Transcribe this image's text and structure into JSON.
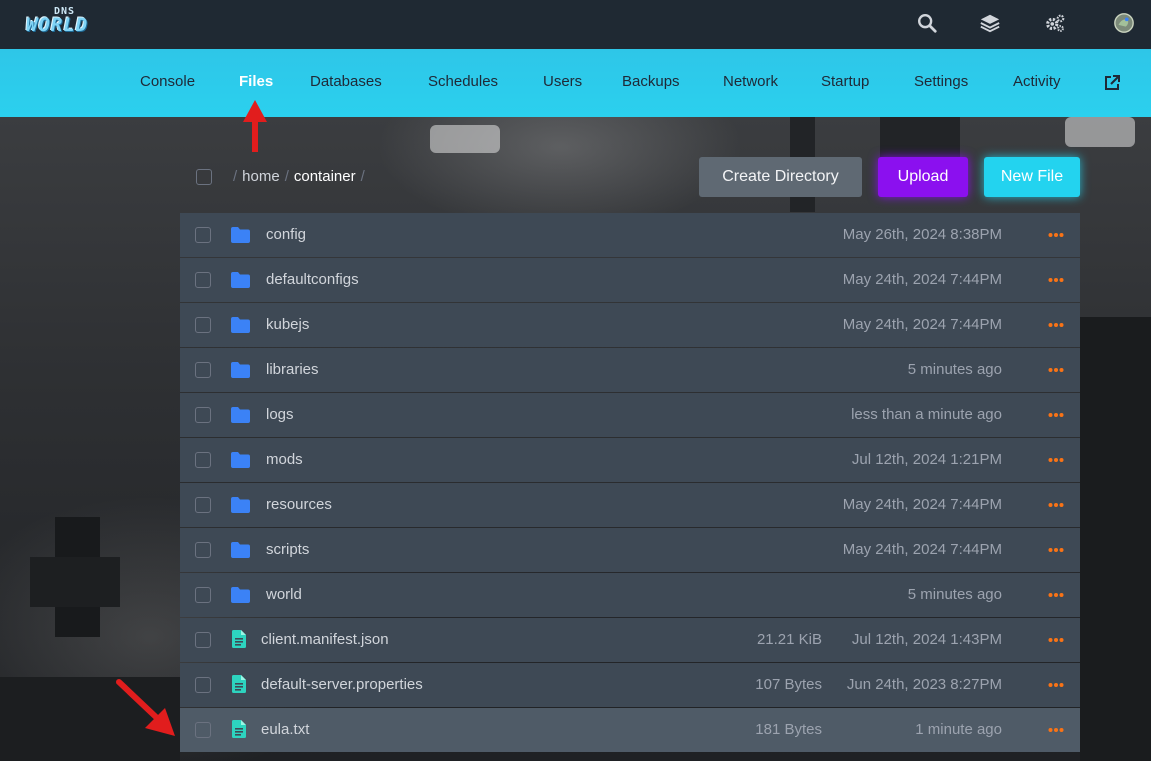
{
  "app": {
    "logo_top": "DNS",
    "logo_main": "WORLD"
  },
  "header": {
    "icons": [
      "search-icon",
      "layers-icon",
      "cogs-icon",
      "avatar-icon"
    ]
  },
  "nav": {
    "items": [
      {
        "label": "Console",
        "active": false
      },
      {
        "label": "Files",
        "active": true
      },
      {
        "label": "Databases",
        "active": false
      },
      {
        "label": "Schedules",
        "active": false
      },
      {
        "label": "Users",
        "active": false
      },
      {
        "label": "Backups",
        "active": false
      },
      {
        "label": "Network",
        "active": false
      },
      {
        "label": "Startup",
        "active": false
      },
      {
        "label": "Settings",
        "active": false
      },
      {
        "label": "Activity",
        "active": false
      }
    ],
    "external_icon": "external-link-icon"
  },
  "breadcrumb": {
    "segments": [
      "home",
      "container"
    ],
    "separator": "/"
  },
  "toolbar": {
    "create_directory": "Create Directory",
    "upload": "Upload",
    "new_file": "New File"
  },
  "files": [
    {
      "name": "config",
      "type": "folder",
      "size": "",
      "modified": "May 26th, 2024 8:38PM"
    },
    {
      "name": "defaultconfigs",
      "type": "folder",
      "size": "",
      "modified": "May 24th, 2024 7:44PM"
    },
    {
      "name": "kubejs",
      "type": "folder",
      "size": "",
      "modified": "May 24th, 2024 7:44PM"
    },
    {
      "name": "libraries",
      "type": "folder",
      "size": "",
      "modified": "5 minutes ago"
    },
    {
      "name": "logs",
      "type": "folder",
      "size": "",
      "modified": "less than a minute ago"
    },
    {
      "name": "mods",
      "type": "folder",
      "size": "",
      "modified": "Jul 12th, 2024 1:21PM"
    },
    {
      "name": "resources",
      "type": "folder",
      "size": "",
      "modified": "May 24th, 2024 7:44PM"
    },
    {
      "name": "scripts",
      "type": "folder",
      "size": "",
      "modified": "May 24th, 2024 7:44PM"
    },
    {
      "name": "world",
      "type": "folder",
      "size": "",
      "modified": "5 minutes ago"
    },
    {
      "name": "client.manifest.json",
      "type": "file",
      "size": "21.21 KiB",
      "modified": "Jul 12th, 2024 1:43PM"
    },
    {
      "name": "default-server.properties",
      "type": "file",
      "size": "107 Bytes",
      "modified": "Jun 24th, 2023 8:27PM"
    },
    {
      "name": "eula.txt",
      "type": "file",
      "size": "181 Bytes",
      "modified": "1 minute ago",
      "highlighted": true
    }
  ],
  "colors": {
    "topbar": "#1f2933",
    "navbar": "#2bcbec",
    "row": "#3e4955",
    "folder_icon": "#3b82f6",
    "file_icon": "#2dd4bf",
    "more_icon": "#f97316",
    "annotation_arrow": "#e11d1d"
  }
}
